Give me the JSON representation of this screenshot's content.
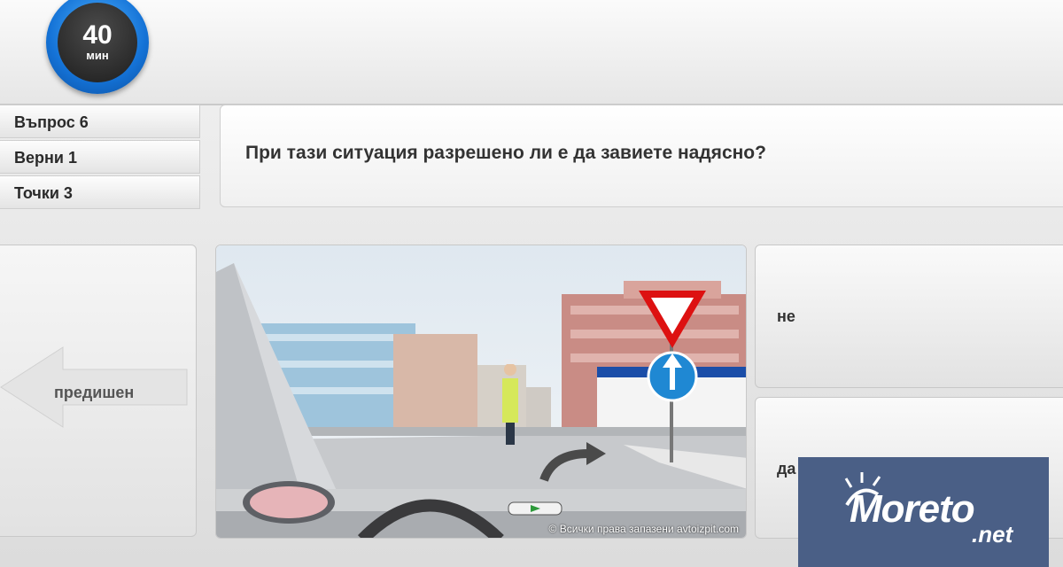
{
  "timer": {
    "value": "40",
    "unit": "мин"
  },
  "stats": [
    {
      "label": "Въпрос 6"
    },
    {
      "label": "Верни 1"
    },
    {
      "label": "Точки 3"
    }
  ],
  "question": {
    "text": "При тази ситуация разрешено ли е да завиете надясно?"
  },
  "navigation": {
    "previous_label": "предишен"
  },
  "image": {
    "copyright": "© Всички права запазени avtoizpit.com"
  },
  "answers": [
    {
      "label": "не"
    },
    {
      "label": "да"
    }
  ],
  "logo": {
    "name": "Moreto",
    "suffix": ".net"
  },
  "colors": {
    "timer_ring": "#1472d6",
    "logo_bg": "#4a5f86"
  }
}
